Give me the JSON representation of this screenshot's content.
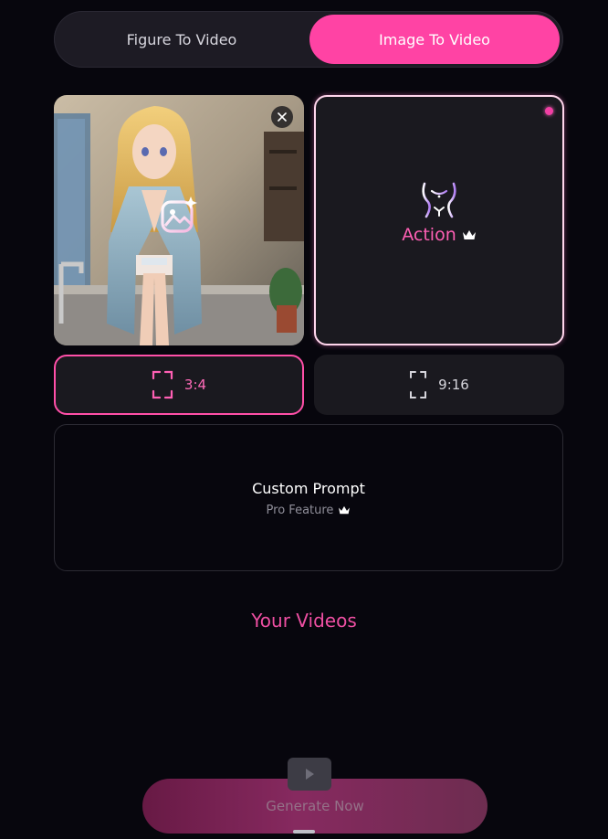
{
  "mode_tabs": [
    {
      "label": "Figure To Video",
      "selected": false
    },
    {
      "label": "Image To Video",
      "selected": true
    }
  ],
  "image_card": {
    "icon": "image-sparkle-icon",
    "remove_icon": "close-icon"
  },
  "action_card": {
    "label": "Action",
    "icon": "body-outline-icon",
    "badge_icon": "crown-icon",
    "selected": true
  },
  "aspect_ratios": [
    {
      "label": "3:4",
      "selected": true,
      "icon": "frame-icon"
    },
    {
      "label": "9:16",
      "selected": false,
      "icon": "frame-icon"
    }
  ],
  "custom_prompt": {
    "title": "Custom Prompt",
    "subtitle": "Pro Feature",
    "badge_icon": "crown-icon"
  },
  "videos_section": {
    "title": "Your Videos"
  },
  "generate_button": {
    "label": "Generate Now",
    "icon": "play-icon"
  },
  "colors": {
    "accent": "#ff43a4",
    "accent_text": "#ff5fb4",
    "background": "#07060d",
    "card": "#1a191f"
  }
}
